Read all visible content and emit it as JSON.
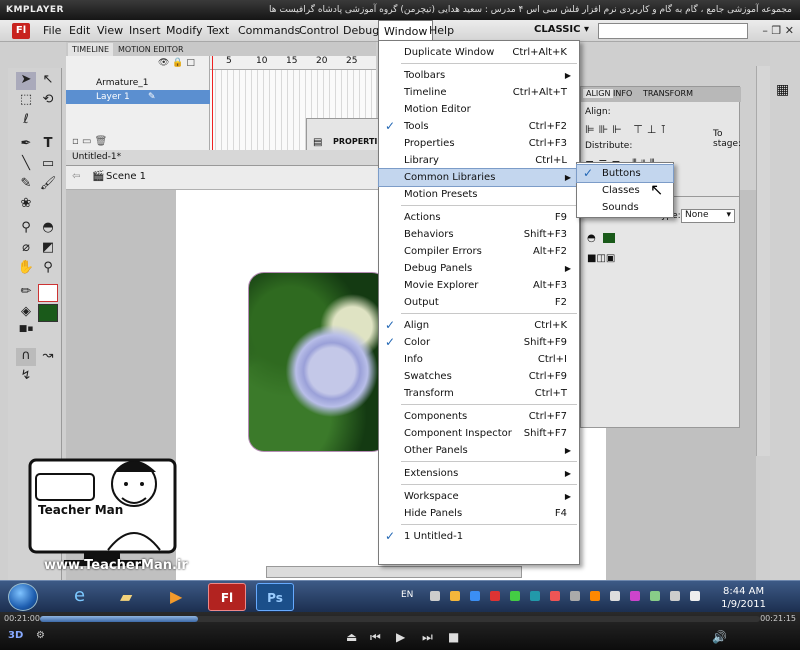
{
  "kmplayer": {
    "logo": "KMPLAYER",
    "caption": "مجموعه آموزشی جامع ، گام به گام و کاربردی نرم افزار فلش سی اس ۴ مدرس : سعید هدایی (تیچرمن) گروه آموزشی پادشاه گرافیست ها"
  },
  "menubar": {
    "app_logo": "Fl",
    "items": [
      "File",
      "Edit",
      "View",
      "Insert",
      "Modify",
      "Text",
      "Commands",
      "Control",
      "Debug",
      "Window",
      "Help"
    ],
    "workspace": "CLASSIC"
  },
  "timeline": {
    "tabs": [
      "TIMELINE",
      "MOTION EDITOR"
    ],
    "layers": [
      "Armature_1",
      "Layer 1"
    ],
    "frame_numbers": [
      "5",
      "10",
      "15",
      "20",
      "25"
    ]
  },
  "document": {
    "tab": "Untitled-1*",
    "scene": "Scene 1"
  },
  "properties_box": {
    "label": "PROPERTIES"
  },
  "align_panel": {
    "tabs": [
      "ALIGN",
      "INFO",
      "TRANSFORM"
    ],
    "align_label": "Align:",
    "distribute_label": "Distribute:",
    "to_stage": "To stage:"
  },
  "prop_panel": {
    "type_label": "Type:",
    "type_value": "None"
  },
  "window_menu": {
    "items": [
      {
        "label": "Duplicate Window",
        "shortcut": "Ctrl+Alt+K",
        "checked": false,
        "submenu": false
      },
      {
        "sep": true
      },
      {
        "label": "Toolbars",
        "shortcut": "",
        "checked": false,
        "submenu": true
      },
      {
        "label": "Timeline",
        "shortcut": "Ctrl+Alt+T",
        "checked": false,
        "submenu": false
      },
      {
        "label": "Motion Editor",
        "shortcut": "",
        "checked": false,
        "submenu": false
      },
      {
        "label": "Tools",
        "shortcut": "Ctrl+F2",
        "checked": true,
        "submenu": false
      },
      {
        "label": "Properties",
        "shortcut": "Ctrl+F3",
        "checked": false,
        "submenu": false
      },
      {
        "label": "Library",
        "shortcut": "Ctrl+L",
        "checked": false,
        "submenu": false
      },
      {
        "label": "Common Libraries",
        "shortcut": "",
        "checked": false,
        "submenu": true,
        "highlight": true
      },
      {
        "label": "Motion Presets",
        "shortcut": "",
        "checked": false,
        "submenu": false
      },
      {
        "sep": true
      },
      {
        "label": "Actions",
        "shortcut": "F9",
        "checked": false,
        "submenu": false
      },
      {
        "label": "Behaviors",
        "shortcut": "Shift+F3",
        "checked": false,
        "submenu": false
      },
      {
        "label": "Compiler Errors",
        "shortcut": "Alt+F2",
        "checked": false,
        "submenu": false
      },
      {
        "label": "Debug Panels",
        "shortcut": "",
        "checked": false,
        "submenu": true
      },
      {
        "label": "Movie Explorer",
        "shortcut": "Alt+F3",
        "checked": false,
        "submenu": false
      },
      {
        "label": "Output",
        "shortcut": "F2",
        "checked": false,
        "submenu": false
      },
      {
        "sep": true
      },
      {
        "label": "Align",
        "shortcut": "Ctrl+K",
        "checked": true,
        "submenu": false
      },
      {
        "label": "Color",
        "shortcut": "Shift+F9",
        "checked": true,
        "submenu": false
      },
      {
        "label": "Info",
        "shortcut": "Ctrl+I",
        "checked": false,
        "submenu": false
      },
      {
        "label": "Swatches",
        "shortcut": "Ctrl+F9",
        "checked": false,
        "submenu": false
      },
      {
        "label": "Transform",
        "shortcut": "Ctrl+T",
        "checked": false,
        "submenu": false
      },
      {
        "sep": true
      },
      {
        "label": "Components",
        "shortcut": "Ctrl+F7",
        "checked": false,
        "submenu": false
      },
      {
        "label": "Component Inspector",
        "shortcut": "Shift+F7",
        "checked": false,
        "submenu": false
      },
      {
        "label": "Other Panels",
        "shortcut": "",
        "checked": false,
        "submenu": true
      },
      {
        "sep": true
      },
      {
        "label": "Extensions",
        "shortcut": "",
        "checked": false,
        "submenu": true
      },
      {
        "sep": true
      },
      {
        "label": "Workspace",
        "shortcut": "",
        "checked": false,
        "submenu": true
      },
      {
        "label": "Hide Panels",
        "shortcut": "F4",
        "checked": false,
        "submenu": false
      },
      {
        "sep": true
      },
      {
        "label": "1 Untitled-1",
        "shortcut": "",
        "checked": true,
        "submenu": false
      }
    ]
  },
  "common_libraries_submenu": {
    "items": [
      {
        "label": "Buttons",
        "checked": true
      },
      {
        "label": "Classes",
        "checked": false
      },
      {
        "label": "Sounds",
        "checked": false
      }
    ]
  },
  "watermark": {
    "name": "Teacher Man",
    "site": "www.TeacherMan.ir"
  },
  "taskbar": {
    "apps": [
      "Fl",
      "Ps"
    ],
    "lang": "EN",
    "time": "8:44 AM",
    "date": "1/9/2011"
  },
  "player": {
    "current_time": "00:21:00",
    "total_time": "00:21:15",
    "progress": 0.22
  }
}
